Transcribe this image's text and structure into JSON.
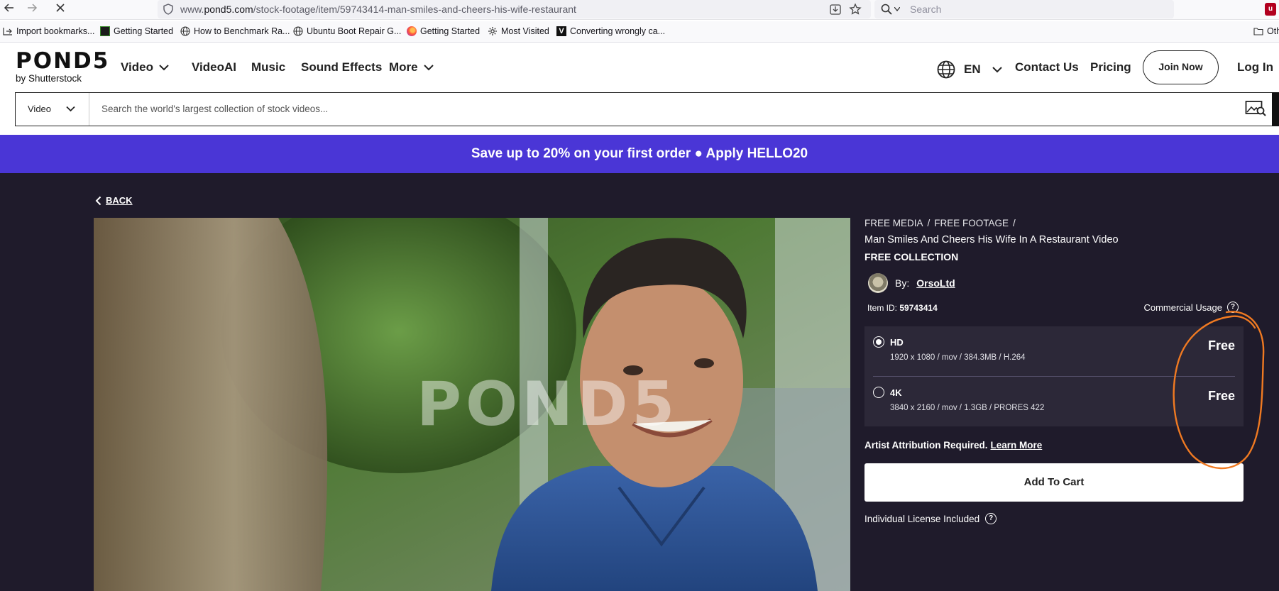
{
  "browser": {
    "back_icon": "arrow-left-icon",
    "forward_icon": "arrow-right-icon",
    "reload_icon": "stop-icon",
    "url_prefix": "www.",
    "url_domain": "pond5.com",
    "url_path": "/stock-footage/item/59743414-man-smiles-and-cheers-his-wife-restaurant",
    "search_placeholder": "Search",
    "bookmarks": [
      {
        "label": "Import bookmarks...",
        "icon": "import-icon"
      },
      {
        "label": "Getting Started",
        "icon": "page-icon"
      },
      {
        "label": "How to Benchmark Ra...",
        "icon": "globe-icon"
      },
      {
        "label": "Ubuntu Boot Repair G...",
        "icon": "globe-icon"
      },
      {
        "label": "Getting Started",
        "icon": "firefox-icon"
      },
      {
        "label": "Most Visited",
        "icon": "gear-icon"
      },
      {
        "label": "Converting wrongly ca...",
        "icon": "v-icon"
      }
    ],
    "other_bookmarks": "Oth"
  },
  "header": {
    "logo_word": "POND5",
    "logo_sub": "by Shutterstock",
    "nav": {
      "video": "Video",
      "videoai": "VideoAI",
      "music": "Music",
      "sound_effects": "Sound Effects",
      "more": "More"
    },
    "language": "EN",
    "contact": "Contact Us",
    "pricing": "Pricing",
    "join": "Join Now",
    "login": "Log In"
  },
  "search": {
    "category": "Video",
    "placeholder": "Search the world's largest collection of stock videos..."
  },
  "promo": {
    "text": "Save up to 20% on your first order ● Apply HELLO20"
  },
  "page": {
    "back": "BACK",
    "watermark": "POND5",
    "breadcrumb": [
      "FREE MEDIA",
      "FREE FOOTAGE"
    ],
    "breadcrumb_sep": "/",
    "title": "Man Smiles And Cheers His Wife In A Restaurant Video",
    "collection": "FREE COLLECTION",
    "by_label": "By:",
    "author": "OrsoLtd",
    "item_id_label": "Item ID:",
    "item_id": "59743414",
    "commercial_usage": "Commercial Usage",
    "formats": [
      {
        "name": "HD",
        "spec": "1920 x 1080 / mov / 384.3MB / H.264",
        "price": "Free",
        "selected": true
      },
      {
        "name": "4K",
        "spec": "3840 x 2160 / mov / 1.3GB / PRORES 422",
        "price": "Free",
        "selected": false
      }
    ],
    "attribution": "Artist Attribution Required.",
    "learn_more": "Learn More",
    "add_to_cart": "Add To Cart",
    "license": "Individual License Included"
  },
  "colors": {
    "promo_bg": "#4a36d6",
    "dark_bg": "#1f1b2b",
    "format_bg": "#2c2838",
    "annotation": "#f07a22"
  }
}
